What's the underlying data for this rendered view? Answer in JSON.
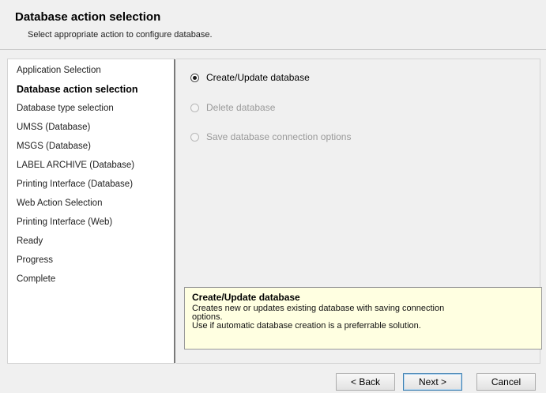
{
  "header": {
    "title": "Database action selection",
    "subtitle": "Select appropriate action to configure database."
  },
  "steps": [
    {
      "label": "Application Selection",
      "current": false
    },
    {
      "label": "Database action selection",
      "current": true
    },
    {
      "label": "Database type selection",
      "current": false
    },
    {
      "label": "UMSS (Database)",
      "current": false
    },
    {
      "label": "MSGS (Database)",
      "current": false
    },
    {
      "label": "LABEL ARCHIVE (Database)",
      "current": false
    },
    {
      "label": "Printing Interface (Database)",
      "current": false
    },
    {
      "label": "Web Action Selection",
      "current": false
    },
    {
      "label": "Printing Interface (Web)",
      "current": false
    },
    {
      "label": "Ready",
      "current": false
    },
    {
      "label": "Progress",
      "current": false
    },
    {
      "label": "Complete",
      "current": false
    }
  ],
  "options": [
    {
      "label": "Create/Update database",
      "checked": true,
      "enabled": true
    },
    {
      "label": "Delete database",
      "checked": false,
      "enabled": false
    },
    {
      "label": "Save database connection options",
      "checked": false,
      "enabled": false
    }
  ],
  "info": {
    "title": "Create/Update database",
    "line1": "Creates new or updates existing database with saving connection options.",
    "line2": "Use if automatic database creation is a preferrable solution."
  },
  "buttons": {
    "back": "< Back",
    "next": "Next >",
    "cancel": "Cancel"
  }
}
